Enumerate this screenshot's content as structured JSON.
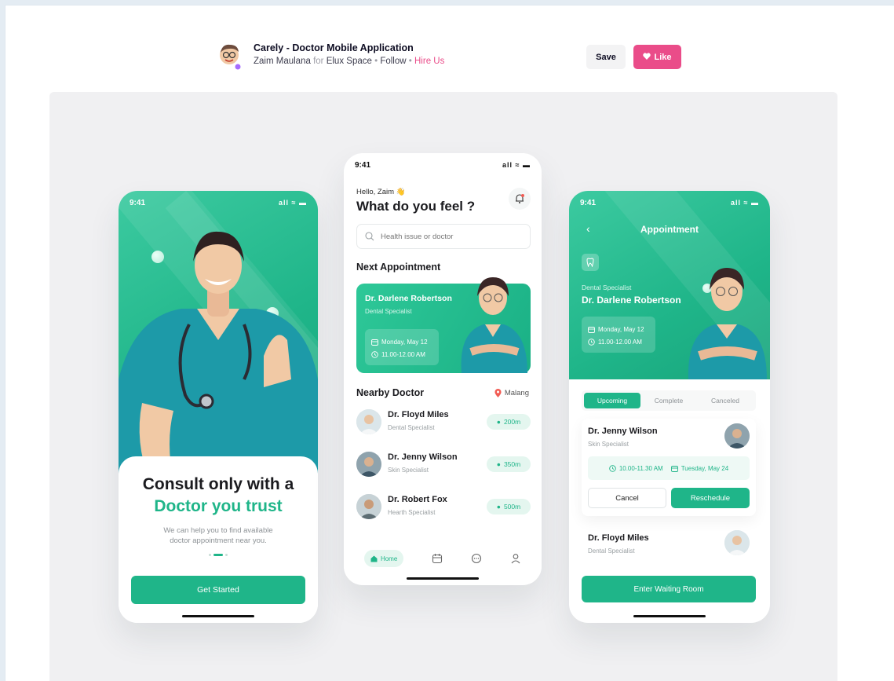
{
  "header": {
    "shot_title": "Carely - Doctor Mobile Application",
    "author": "Zaim Maulana",
    "for_word": "for",
    "team": "Elux Space",
    "separator": "•",
    "follow": "Follow",
    "hire": "Hire Us",
    "save_label": "Save",
    "like_label": "Like"
  },
  "colors": {
    "brand": "#1fb589",
    "like": "#ea4c89",
    "canvas": "#f0f0f2"
  },
  "onboarding": {
    "time": "9:41",
    "signal": "all ≈ ▬",
    "headline": "Consult only with a",
    "headline_accent": "Doctor you trust",
    "subtitle": "We can help you to find available doctor appointment near you.",
    "cta": "Get Started",
    "page_dots": 3,
    "active_dot": 2
  },
  "home": {
    "time": "9:41",
    "signal": "all ≈ ▬",
    "greeting": "Hello, Zaim 👋",
    "question": "What do you feel ?",
    "search_placeholder": "Health issue or doctor",
    "next_appointment_title": "Next Appointment",
    "appointment": {
      "doctor": "Dr. Darlene Robertson",
      "specialty": "Dental Specialist",
      "date": "Monday, May 12",
      "time": "11.00-12.00 AM"
    },
    "nearby_title": "Nearby Doctor",
    "location": "Malang",
    "nearby": [
      {
        "name": "Dr. Floyd Miles",
        "specialty": "Dental Specialist",
        "distance": "200m"
      },
      {
        "name": "Dr. Jenny Wilson",
        "specialty": "Skin Specialist",
        "distance": "350m"
      },
      {
        "name": "Dr. Robert Fox",
        "specialty": "Hearth Specialist",
        "distance": "500m"
      }
    ],
    "tabs": {
      "home": "Home"
    }
  },
  "appointment_screen": {
    "time": "9:41",
    "signal": "all ≈ ▬",
    "title": "Appointment",
    "specialty": "Dental Specialist",
    "doctor": "Dr. Darlene Robertson",
    "date": "Monday, May 12",
    "time_slot": "11.00-12.00 AM",
    "segments": [
      "Upcoming",
      "Complete",
      "Canceled"
    ],
    "active_segment": 0,
    "upcoming": [
      {
        "name": "Dr. Jenny Wilson",
        "specialty": "Skin Specialist",
        "time": "10.00-11.30 AM",
        "date": "Tuesday, May 24",
        "cancel": "Cancel",
        "reschedule": "Reschedule"
      },
      {
        "name": "Dr. Floyd Miles",
        "specialty": "Dental Specialist"
      }
    ],
    "waiting_room": "Enter Waiting Room"
  }
}
